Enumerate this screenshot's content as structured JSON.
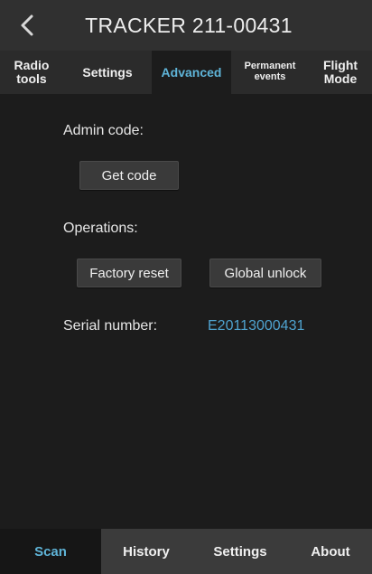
{
  "header": {
    "title": "TRACKER 211-00431"
  },
  "tabs": [
    {
      "line1": "Radio",
      "line2": "tools"
    },
    {
      "line1": "Settings",
      "line2": ""
    },
    {
      "line1": "Advanced",
      "line2": ""
    },
    {
      "line1": "Permanent",
      "line2": "events"
    },
    {
      "line1": "Flight",
      "line2": "Mode"
    }
  ],
  "admin": {
    "label": "Admin code:",
    "button": "Get code"
  },
  "operations": {
    "label": "Operations:",
    "factory_reset": "Factory reset",
    "global_unlock": "Global unlock"
  },
  "serial": {
    "label": "Serial number:",
    "value": "E20113000431"
  },
  "bottom_nav": [
    "Scan",
    "History",
    "Settings",
    "About"
  ],
  "colors": {
    "accent": "#5fb4d8",
    "serial_link": "#4fa3cf",
    "background": "#1c1c1c"
  },
  "icons": {
    "back": "chevron-left-icon"
  }
}
